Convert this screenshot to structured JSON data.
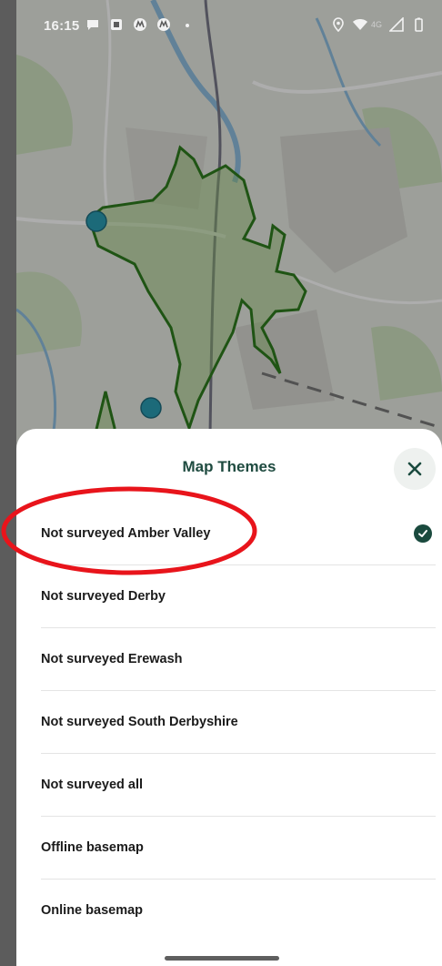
{
  "status_bar": {
    "time": "16:15",
    "left_icons": [
      "message-icon",
      "app-icon",
      "motorola-icon",
      "motorola-icon",
      "dot-icon"
    ],
    "right_icons": [
      "location-icon",
      "wifi-icon",
      "network-icon",
      "signal-icon",
      "battery-icon"
    ],
    "network_label": "4G"
  },
  "map": {
    "boundary_color": "#2f7d1e",
    "marker_color": "#2a9db3"
  },
  "sheet": {
    "title": "Map Themes",
    "close_icon": "close-icon",
    "accent_color": "#1a4a3e",
    "items": [
      {
        "label": "Not surveyed Amber Valley",
        "selected": true
      },
      {
        "label": "Not surveyed Derby",
        "selected": false
      },
      {
        "label": "Not surveyed Erewash",
        "selected": false
      },
      {
        "label": "Not surveyed South Derbyshire",
        "selected": false
      },
      {
        "label": "Not surveyed all",
        "selected": false
      },
      {
        "label": "Offline basemap",
        "selected": false
      },
      {
        "label": "Online basemap",
        "selected": false
      }
    ]
  },
  "annotation": {
    "color": "#e8141b"
  }
}
